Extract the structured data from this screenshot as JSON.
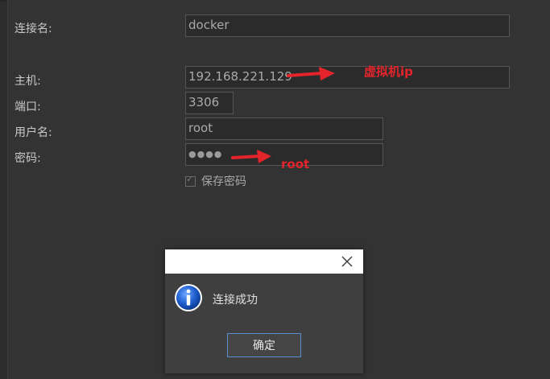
{
  "form": {
    "connection_name": {
      "label": "连接名:",
      "value": "docker"
    },
    "host": {
      "label": "主机:",
      "value": "192.168.221.129"
    },
    "port": {
      "label": "端口:",
      "value": "3306"
    },
    "username": {
      "label": "用户名:",
      "value": "root"
    },
    "password": {
      "label": "密码:",
      "value": "●●●●"
    },
    "save_password": {
      "label": "保存密码",
      "checked": true
    }
  },
  "annotations": {
    "host_note": "虚拟机ip",
    "password_note": "root",
    "color": "#e3242b"
  },
  "dialog": {
    "message": "连接成功",
    "ok_label": "确定",
    "icon": "info-icon",
    "close_icon": "close-icon"
  }
}
